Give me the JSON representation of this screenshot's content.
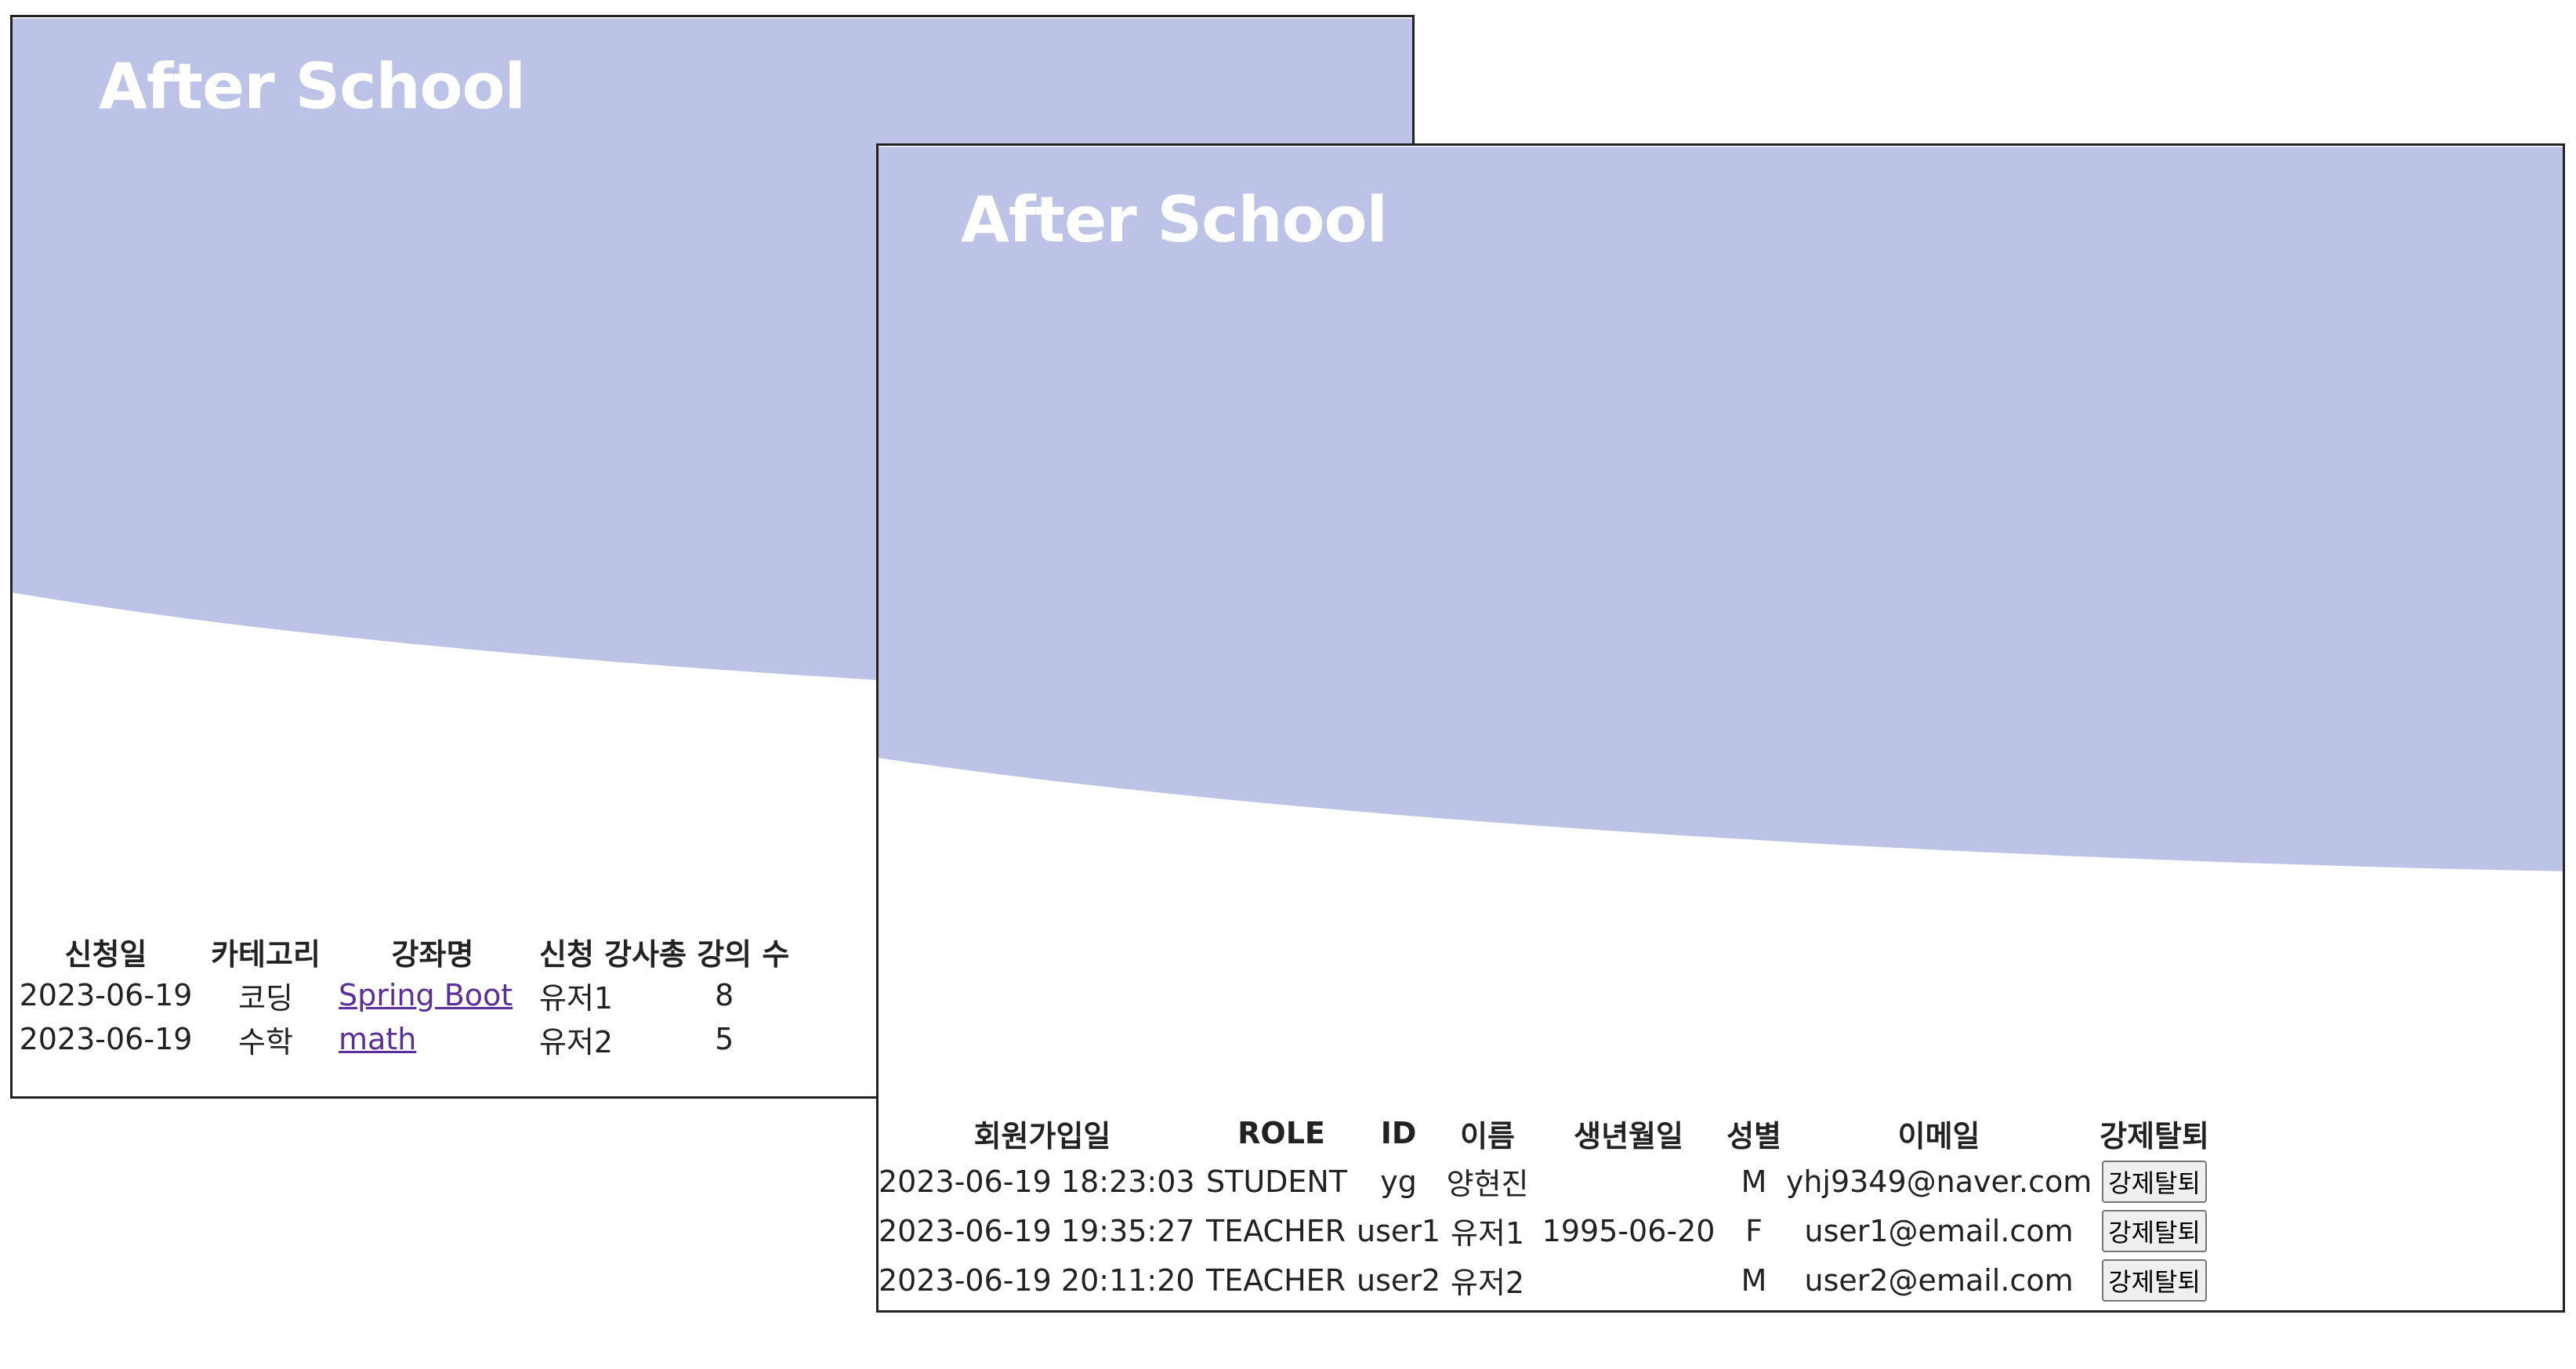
{
  "brand": {
    "logo_text": "After School",
    "hero_color": "#bcc3e6"
  },
  "course_window": {
    "headers": {
      "date": "신청일",
      "category": "카테고리",
      "course_name": "강좌명",
      "teacher": "신청 강사",
      "lecture_count": "총 강의 수"
    },
    "rows": [
      {
        "date": "2023-06-19",
        "category": "코딩",
        "course_name": "Spring Boot",
        "teacher": "유저1",
        "lecture_count": "8"
      },
      {
        "date": "2023-06-19",
        "category": "수학",
        "course_name": "math",
        "teacher": "유저2",
        "lecture_count": "5"
      }
    ]
  },
  "member_window": {
    "headers": {
      "join_date": "회원가입일",
      "role": "ROLE",
      "id": "ID",
      "name": "이름",
      "birth": "생년월일",
      "gender": "성별",
      "email": "이메일",
      "kick": "강제탈퇴"
    },
    "rows": [
      {
        "join_date": "2023-06-19 18:23:03",
        "role": "STUDENT",
        "id": "yg",
        "name": "양현진",
        "birth": "",
        "gender": "M",
        "email": "yhj9349@naver.com",
        "kick_label": "강제탈퇴"
      },
      {
        "join_date": "2023-06-19 19:35:27",
        "role": "TEACHER",
        "id": "user1",
        "name": "유저1",
        "birth": "1995-06-20",
        "gender": "F",
        "email": "user1@email.com",
        "kick_label": "강제탈퇴"
      },
      {
        "join_date": "2023-06-19 20:11:20",
        "role": "TEACHER",
        "id": "user2",
        "name": "유저2",
        "birth": "",
        "gender": "M",
        "email": "user2@email.com",
        "kick_label": "강제탈퇴"
      }
    ]
  }
}
